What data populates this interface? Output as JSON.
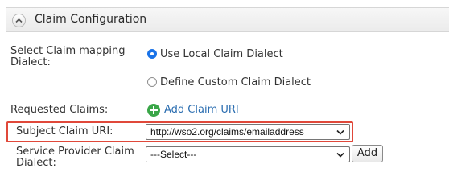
{
  "panel": {
    "title": "Claim Configuration"
  },
  "dialect": {
    "label": "Select Claim mapping Dialect:",
    "option_local": "Use Local Claim Dialect",
    "option_custom": "Define Custom Claim Dialect",
    "selected": "option_local"
  },
  "requested_claims": {
    "label": "Requested Claims:",
    "add_link": "Add Claim URI"
  },
  "subject_claim": {
    "label": "Subject Claim URI:",
    "value": "http://wso2.org/claims/emailaddress"
  },
  "sp_claim_dialect": {
    "label": "Service Provider Claim Dialect:",
    "value": "---Select---",
    "add_button": "Add"
  },
  "colors": {
    "accent_blue": "#1a73e8",
    "link_blue": "#2a6db0",
    "add_green": "#3aa648",
    "highlight_red": "#e0483a"
  }
}
